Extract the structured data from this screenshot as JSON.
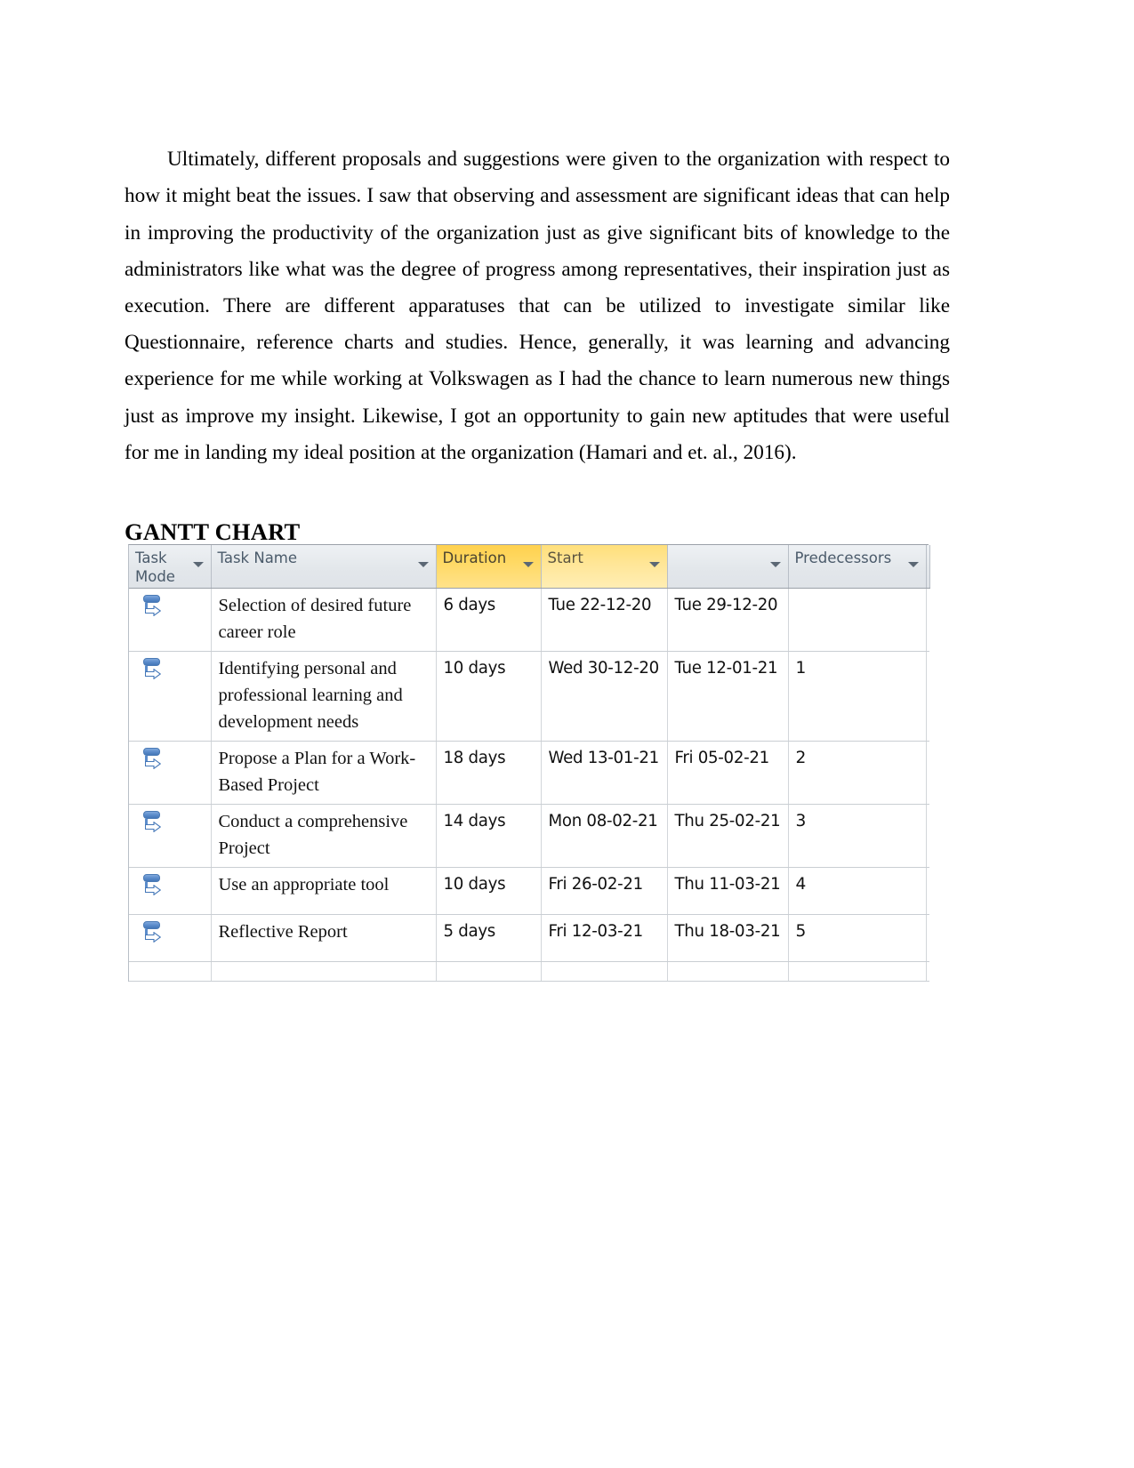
{
  "document": {
    "paragraph": "Ultimately, different proposals and suggestions were given to the organization with respect to how it might beat the issues. I saw that observing and assessment are significant ideas that can help in improving the productivity of the organization just as give significant bits of knowledge to the administrators like what was the degree of progress among representatives, their inspiration just as execution. There are different apparatuses that can be utilized to investigate similar like Questionnaire, reference charts and studies. Hence, generally, it was learning and advancing experience for me while working at Volkswagen as I had the chance to learn numerous new things just as improve my insight. Likewise, I got an opportunity to gain new aptitudes that were useful for me in landing my ideal position at the organization (Hamari and et. al., 2016).",
    "heading": "GANTT CHART"
  },
  "gantt": {
    "colors": {
      "header_gray": "#e3e7eb",
      "header_highlight": "#ffd14e",
      "header_highlight_light": "#ffe698",
      "header_text": "#4a5a6a",
      "grid_line": "#c9ced3",
      "icon_blue": "#5b8ccb"
    },
    "columns": [
      {
        "label_line1": "Task",
        "label_line2": "Mode",
        "highlight": "none"
      },
      {
        "label_line1": "Task Name",
        "label_line2": "",
        "highlight": "none"
      },
      {
        "label_line1": "Duration",
        "label_line2": "",
        "highlight": "strong"
      },
      {
        "label_line1": "Start",
        "label_line2": "",
        "highlight": "light"
      },
      {
        "label_line1": "",
        "label_line2": "",
        "highlight": "none"
      },
      {
        "label_line1": "Predecessors",
        "label_line2": "",
        "highlight": "none"
      },
      {
        "label_line1": "",
        "label_line2": "",
        "highlight": "none"
      }
    ],
    "rows": [
      {
        "mode_icon": "manually-scheduled-task-icon",
        "task_name": "Selection of desired future career role",
        "duration": "6 days",
        "start": "Tue 22-12-20",
        "finish": "Tue 29-12-20",
        "predecessors": ""
      },
      {
        "mode_icon": "manually-scheduled-task-icon",
        "task_name": "Identifying  personal and professional learning and development needs",
        "duration": "10 days",
        "start": "Wed 30-12-20",
        "finish": "Tue 12-01-21",
        "predecessors": "1"
      },
      {
        "mode_icon": "manually-scheduled-task-icon",
        "task_name": "Propose a Plan for a Work-Based Project",
        "duration": "18 days",
        "start": "Wed 13-01-21",
        "finish": "Fri 05-02-21",
        "predecessors": "2"
      },
      {
        "mode_icon": "manually-scheduled-task-icon",
        "task_name": "Conduct a comprehensive Project",
        "duration": "14 days",
        "start": "Mon 08-02-21",
        "finish": "Thu 25-02-21",
        "predecessors": "3"
      },
      {
        "mode_icon": "manually-scheduled-task-icon",
        "task_name": "Use an appropriate tool",
        "duration": "10 days",
        "start": "Fri 26-02-21",
        "finish": "Thu 11-03-21",
        "predecessors": "4"
      },
      {
        "mode_icon": "manually-scheduled-task-icon",
        "task_name": "Reflective Report",
        "duration": "5 days",
        "start": "Fri 12-03-21",
        "finish": "Thu 18-03-21",
        "predecessors": "5"
      }
    ]
  }
}
